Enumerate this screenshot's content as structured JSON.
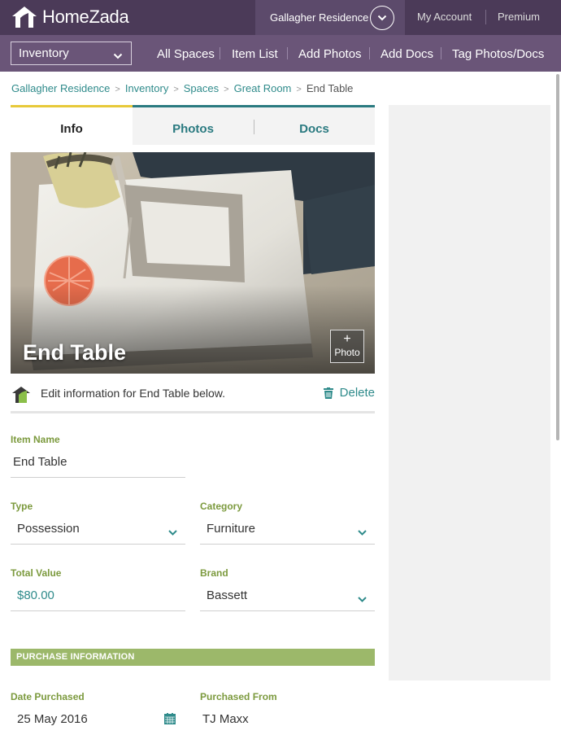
{
  "app": {
    "brand": "HomeZada",
    "residence": "Gallagher Residence",
    "my_account": "My Account",
    "premium": "Premium"
  },
  "nav": {
    "section": "Inventory",
    "links": [
      "All Spaces",
      "Item List",
      "Add Photos",
      "Add Docs",
      "Tag Photos/Docs"
    ]
  },
  "breadcrumb": [
    "Gallagher Residence",
    "Inventory",
    "Spaces",
    "Great Room",
    "End Table"
  ],
  "tabs": {
    "info": "Info",
    "photos": "Photos",
    "docs": "Docs"
  },
  "hero": {
    "title": "End Table",
    "add_photo_plus": "+",
    "add_photo_label": "Photo"
  },
  "edit": {
    "message": "Edit information for End Table below.",
    "delete_label": "Delete"
  },
  "form": {
    "item_name_label": "Item Name",
    "item_name_value": "End Table",
    "type_label": "Type",
    "type_value": "Possession",
    "category_label": "Category",
    "category_value": "Furniture",
    "total_value_label": "Total Value",
    "total_value_value": "$80.00",
    "brand_label": "Brand",
    "brand_value": "Bassett",
    "purchase_section": "PURCHASE INFORMATION",
    "date_purchased_label": "Date Purchased",
    "date_purchased_value": "25 May 2016",
    "purchased_from_label": "Purchased From",
    "purchased_from_value": "TJ Maxx"
  },
  "colors": {
    "header_dark": "#4b3a58",
    "header_nav": "#6a5578",
    "teal": "#2f8b8b",
    "label_green": "#7c9a3e",
    "section_green": "#9cb86a",
    "active_tab_accent": "#e7c93a"
  }
}
